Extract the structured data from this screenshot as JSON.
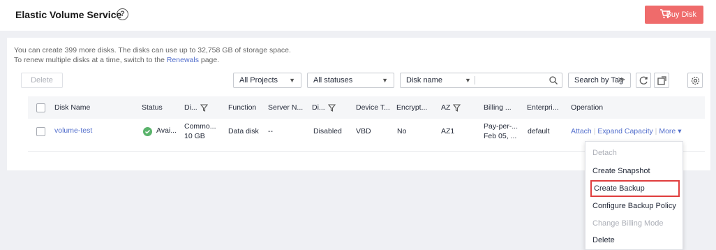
{
  "header": {
    "title": "Elastic Volume Service",
    "help_glyph": "?",
    "buy_label": "Buy Disk",
    "accent": "#ef6b6b"
  },
  "info": {
    "line1": "You can create 399 more disks. The disks can use up to 32,758 GB of storage space.",
    "line2_prefix": "To renew multiple disks at a time, switch to the ",
    "line2_link": "Renewals",
    "line2_suffix": " page."
  },
  "toolbar": {
    "delete_label": "Delete",
    "projects_value": "All Projects",
    "statuses_value": "All statuses",
    "field_value": "Disk name",
    "search_value": "",
    "tag_label": "Search by Tag",
    "tag_glyph": "≫",
    "refresh_icon": "refresh-icon",
    "export_icon": "export-icon",
    "settings_icon": "gear-icon"
  },
  "table": {
    "headers": [
      "Disk Name",
      "Status",
      "Di...",
      "Function",
      "Server N...",
      "Di...",
      "Device T...",
      "Encrypt...",
      "AZ",
      "Billing ...",
      "Enterpri...",
      "Operation"
    ],
    "row": {
      "name": "volume-test",
      "status": "Avai...",
      "type_line1": "Commo...",
      "type_line2": "10 GB",
      "function": "Data disk",
      "server": "--",
      "sharing": "Disabled",
      "device_type": "VBD",
      "encrypted": "No",
      "az": "AZ1",
      "billing_line1": "Pay-per-...",
      "billing_line2": "Feb 05, ...",
      "enterprise": "default",
      "op_attach": "Attach",
      "op_expand": "Expand Capacity",
      "op_more": "More",
      "op_sep": "|",
      "more_glyph": "▾"
    }
  },
  "more_menu": {
    "items": [
      {
        "label": "Detach",
        "disabled": true
      },
      {
        "label": "Create Snapshot",
        "disabled": false
      },
      {
        "label": "Create Backup",
        "disabled": false,
        "highlighted": true
      },
      {
        "label": "Configure Backup Policy",
        "disabled": false
      },
      {
        "label": "Change Billing Mode",
        "disabled": true
      },
      {
        "label": "Delete",
        "disabled": false
      }
    ]
  },
  "search_icon": "search-icon",
  "dropdown_glyph": "▼",
  "status_color": "#5ab36b",
  "link_color": "#526ecc"
}
